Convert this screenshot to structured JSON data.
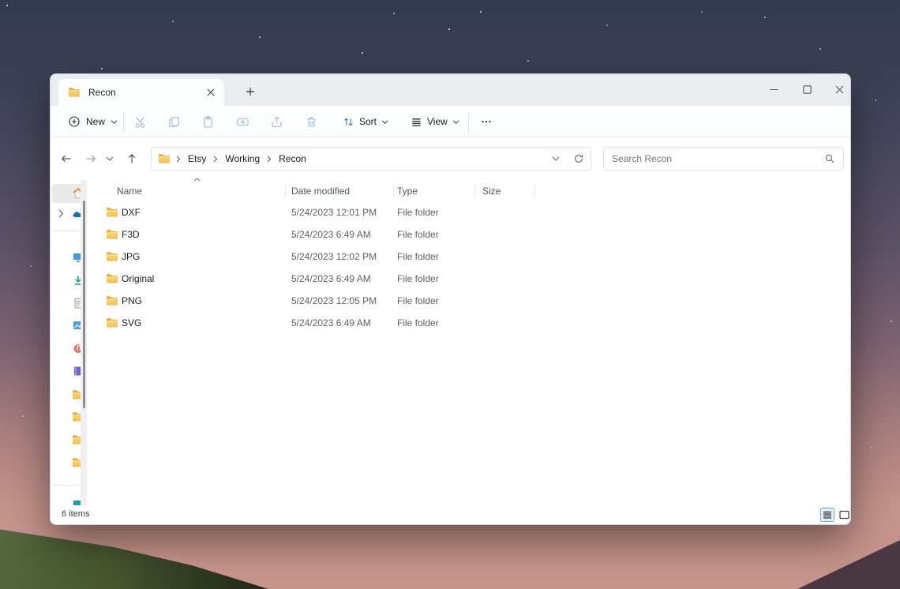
{
  "tab_bar": {
    "tab_title": "Recon"
  },
  "toolbar": {
    "new_label": "New",
    "sort_label": "Sort",
    "view_label": "View",
    "icons": [
      "plus-circle",
      "cut",
      "copy",
      "paste",
      "rename",
      "share",
      "delete",
      "sort-arrows",
      "view-lines",
      "more-ellipsis"
    ]
  },
  "navigation": {
    "icons": [
      "back-arrow",
      "forward-arrow",
      "recent-chevron",
      "up-arrow",
      "refresh"
    ]
  },
  "address": {
    "breadcrumbs": [
      "Etsy",
      "Working",
      "Recon"
    ]
  },
  "search": {
    "placeholder": "Search Recon"
  },
  "file_list": {
    "columns": [
      "Name",
      "Date modified",
      "Type",
      "Size"
    ],
    "sorted_by": "Name",
    "sort_direction": "ascending",
    "rows": [
      {
        "name": "DXF",
        "date_modified": "5/24/2023 12:01 PM",
        "type": "File folder",
        "size": ""
      },
      {
        "name": "F3D",
        "date_modified": "5/24/2023 6:49 AM",
        "type": "File folder",
        "size": ""
      },
      {
        "name": "JPG",
        "date_modified": "5/24/2023 12:02 PM",
        "type": "File folder",
        "size": ""
      },
      {
        "name": "Original",
        "date_modified": "5/24/2023 6:49 AM",
        "type": "File folder",
        "size": ""
      },
      {
        "name": "PNG",
        "date_modified": "5/24/2023 12:05 PM",
        "type": "File folder",
        "size": ""
      },
      {
        "name": "SVG",
        "date_modified": "5/24/2023 6:49 AM",
        "type": "File folder",
        "size": ""
      }
    ]
  },
  "sidebar": {
    "icons": [
      "home",
      "onedrive",
      "desktop",
      "downloads",
      "documents",
      "pictures",
      "music",
      "videos",
      "pinned-folder",
      "pinned-folder",
      "pinned-folder",
      "pinned-folder",
      "this-pc"
    ]
  },
  "status_bar": {
    "items_count": "6 items"
  },
  "colors": {
    "accent_blue": "#0b6cbd",
    "folder_front": "#ffd56b",
    "folder_back": "#e0a33e",
    "disabled_icon_blue": "#a9c3de",
    "selection_grey": "#e9e9e9",
    "active_view_toggle_bg": "#e2f0fa",
    "active_view_toggle_border": "#66aede"
  }
}
